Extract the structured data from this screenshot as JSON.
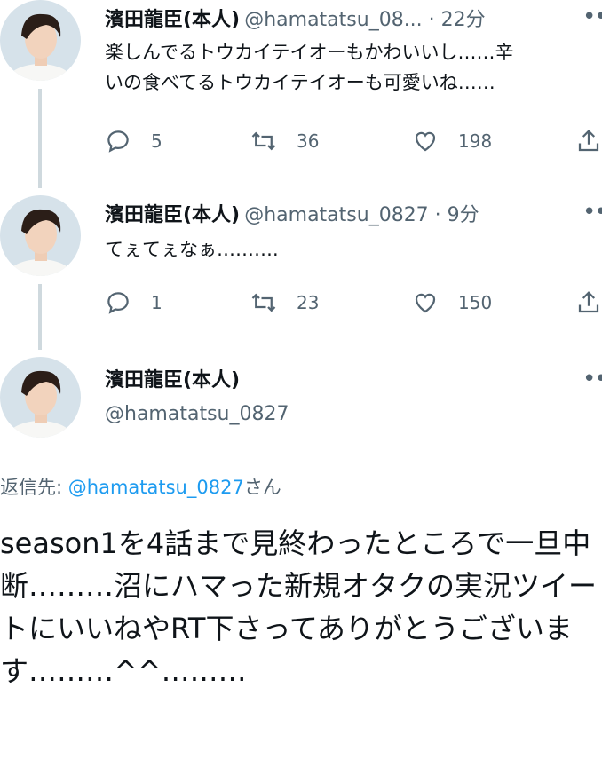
{
  "tweets": [
    {
      "name": "濱田龍臣(本人)",
      "handle": "@hamatatsu_08...",
      "time": " · 22分",
      "text_line1": "楽しんでるトウカイテイオーもかわいいし……辛",
      "text_line2": "いの食べてるトウカイテイオーも可愛いね……",
      "replies": "5",
      "retweets": "36",
      "likes": "198"
    },
    {
      "name": "濱田龍臣(本人)",
      "handle": "@hamatatsu_0827",
      "time": " · 9分",
      "text_line1": "てぇてぇなぁ……….",
      "replies": "1",
      "retweets": "23",
      "likes": "150"
    }
  ],
  "focus": {
    "name": "濱田龍臣(本人)",
    "handle": "@hamatatsu_0827",
    "reply_prefix": "返信先: ",
    "reply_handle": "@hamatatsu_0827",
    "reply_suffix": "さん",
    "text": "season1を4話まで見終わったところで一旦中断………沼にハマった新規オタクの実況ツイートにいいねやRT下さってありがとうございます………^^………"
  },
  "icons": {
    "more": "more-dots-icon",
    "reply": "reply-icon",
    "retweet": "retweet-icon",
    "like": "heart-icon",
    "share": "share-icon"
  },
  "colors": {
    "text": "#0f1419",
    "secondary": "#536471",
    "link": "#1d9bf0",
    "thread_line": "#cfd9de"
  }
}
